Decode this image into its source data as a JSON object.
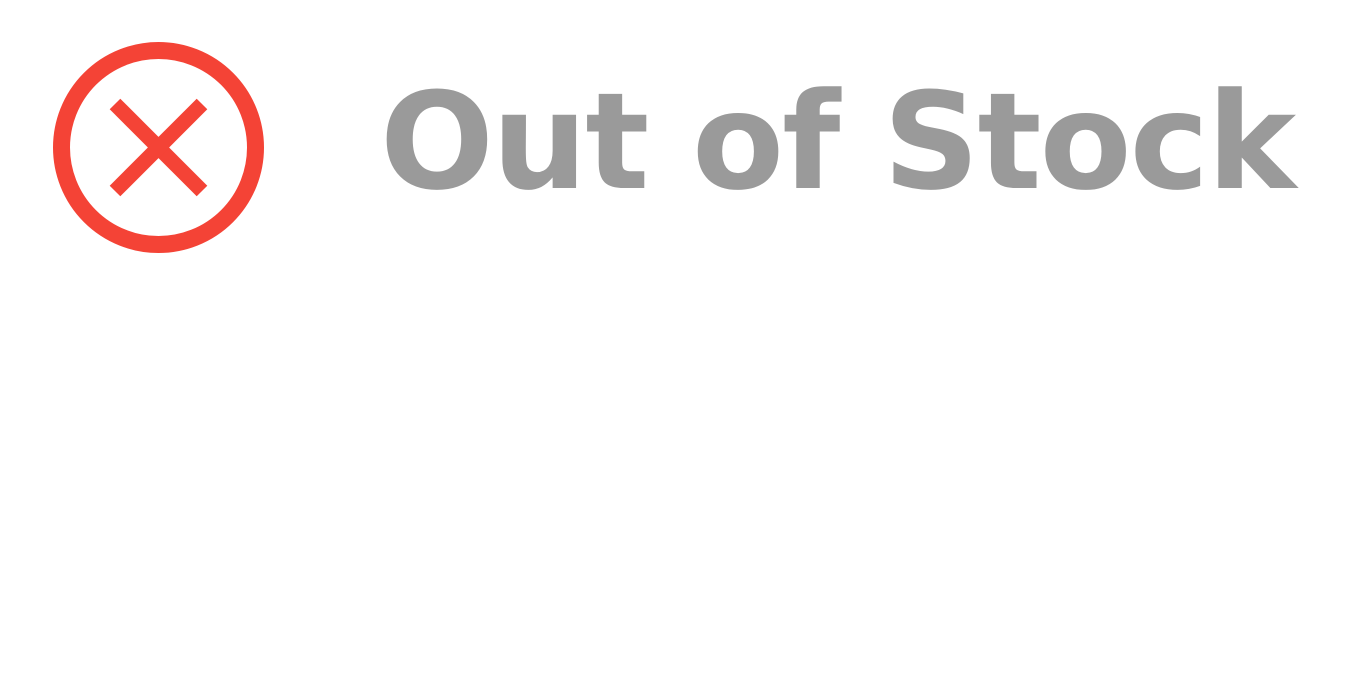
{
  "status": {
    "icon": "x-circle-icon",
    "label": "Out of Stock",
    "icon_color": "#f44336",
    "text_color": "#9a9a9a"
  }
}
